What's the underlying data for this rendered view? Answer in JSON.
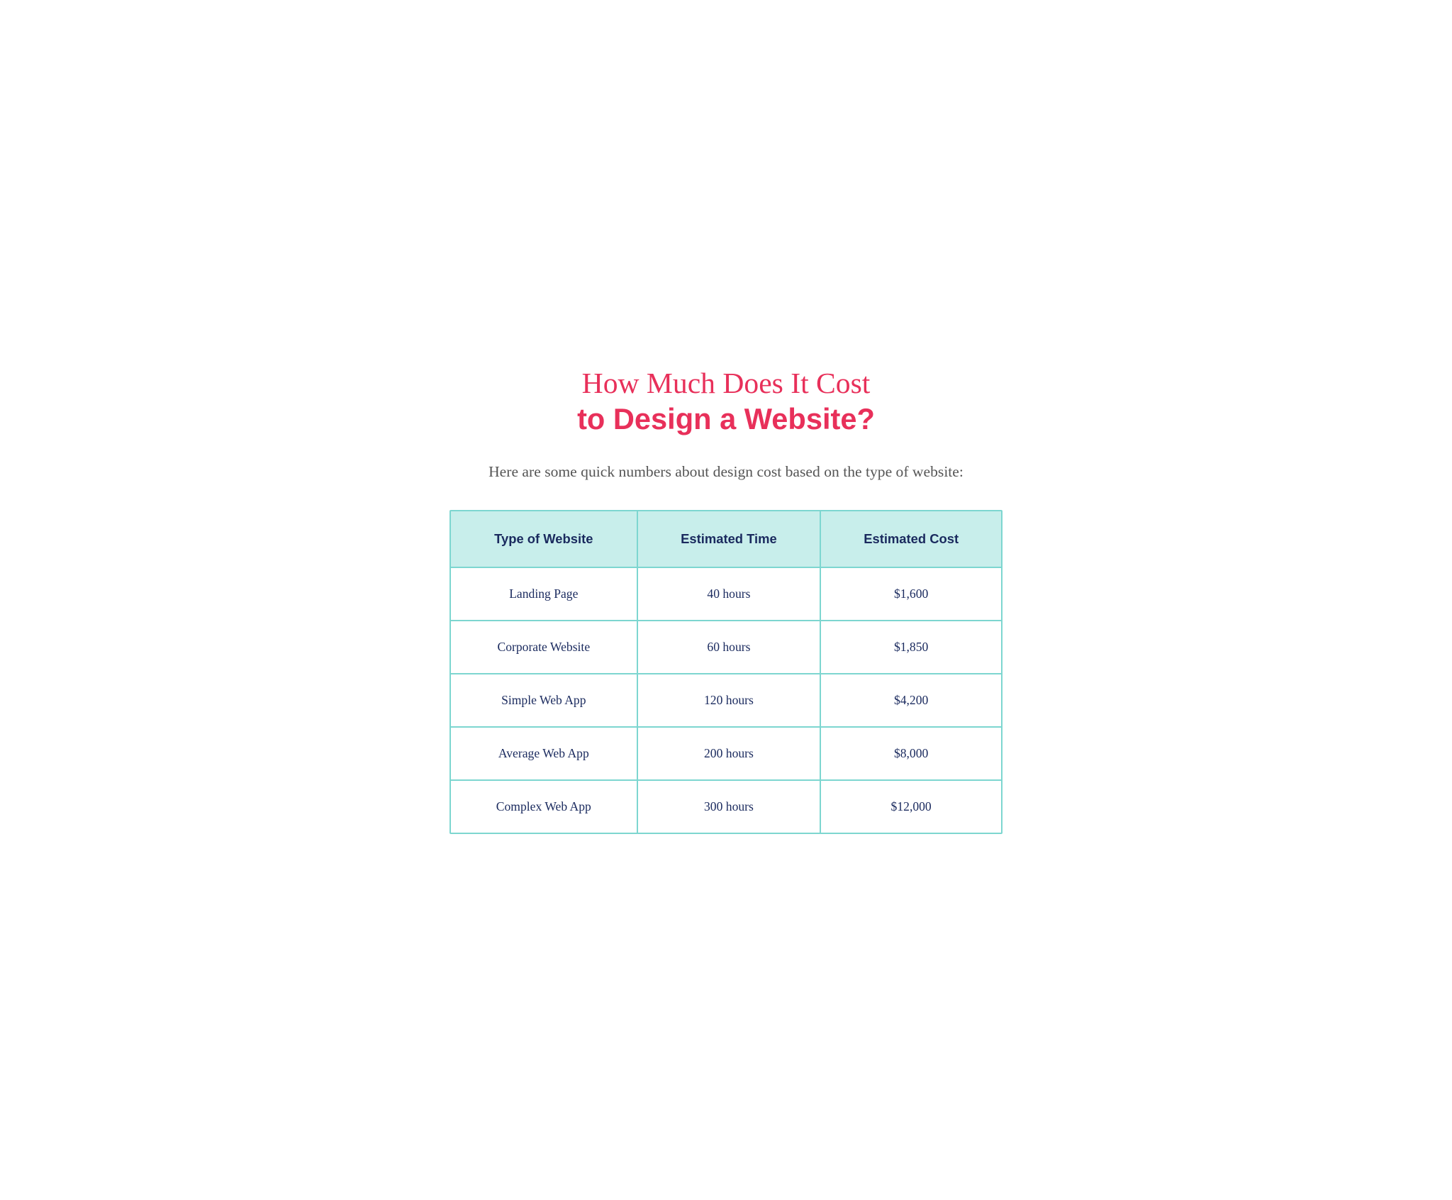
{
  "header": {
    "title_line1": "How Much Does It Cost",
    "title_line2": "to Design a Website?",
    "subtitle": "Here are some quick numbers about design cost based on the type of website:"
  },
  "table": {
    "columns": [
      {
        "key": "type",
        "label": "Type of Website"
      },
      {
        "key": "time",
        "label": "Estimated Time"
      },
      {
        "key": "cost",
        "label": "Estimated Cost"
      }
    ],
    "rows": [
      {
        "type": "Landing Page",
        "time": "40 hours",
        "cost": "$1,600"
      },
      {
        "type": "Corporate Website",
        "time": "60 hours",
        "cost": "$1,850"
      },
      {
        "type": "Simple Web App",
        "time": "120 hours",
        "cost": "$4,200"
      },
      {
        "type": "Average Web App",
        "time": "200 hours",
        "cost": "$8,000"
      },
      {
        "type": "Complex Web App",
        "time": "300 hours",
        "cost": "$12,000"
      }
    ]
  }
}
